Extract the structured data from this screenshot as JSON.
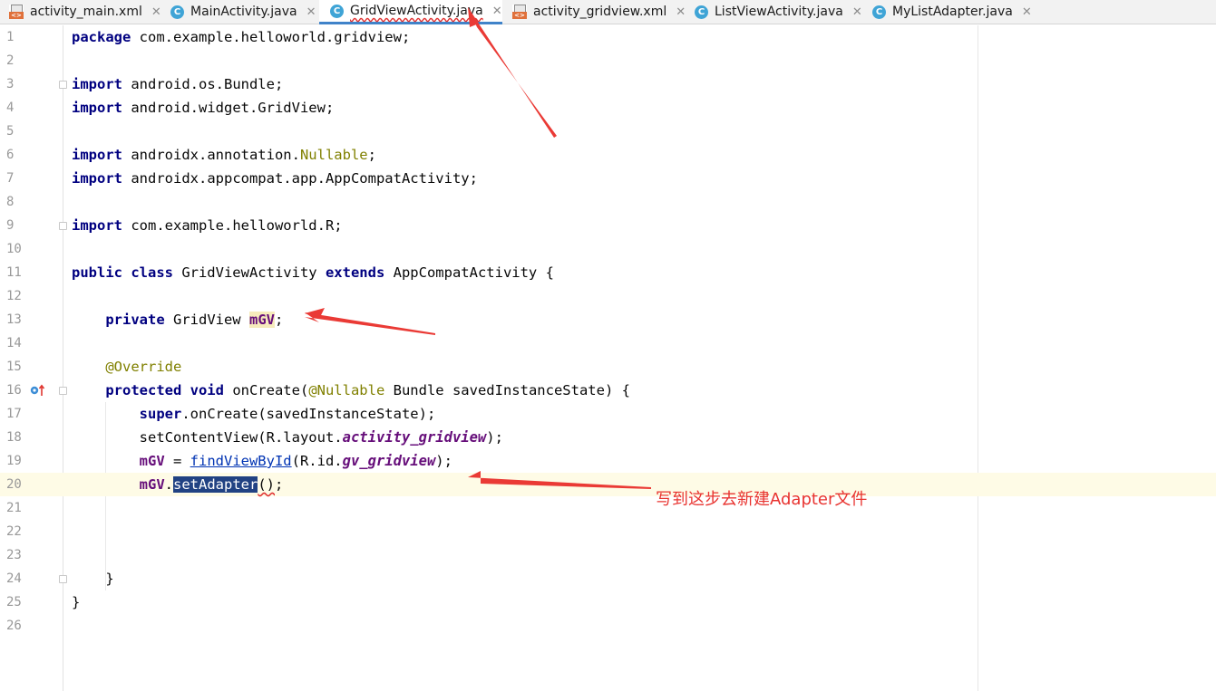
{
  "tabs": [
    {
      "label": "activity_main.xml",
      "type": "xml",
      "active": false
    },
    {
      "label": "MainActivity.java",
      "type": "java",
      "active": false
    },
    {
      "label": "GridViewActivity.java",
      "type": "java",
      "active": true
    },
    {
      "label": "activity_gridview.xml",
      "type": "xml",
      "active": false
    },
    {
      "label": "ListViewActivity.java",
      "type": "java",
      "active": false
    },
    {
      "label": "MyListAdapter.java",
      "type": "java",
      "active": false
    }
  ],
  "icons": {
    "java": "C",
    "xml": "<>",
    "close": "✕"
  },
  "line_numbers": [
    "1",
    "2",
    "3",
    "4",
    "5",
    "6",
    "7",
    "8",
    "9",
    "10",
    "11",
    "12",
    "13",
    "14",
    "15",
    "16",
    "17",
    "18",
    "19",
    "20",
    "21",
    "22",
    "23",
    "24",
    "25",
    "26"
  ],
  "code": {
    "l1_kw": "package",
    "l1_rest": " com.example.helloworld.gridview;",
    "l3_kw": "import",
    "l3_rest": " android.os.Bundle;",
    "l4_kw": "import",
    "l4_rest": " android.widget.GridView;",
    "l6_kw": "import",
    "l6_a": " androidx.annotation.",
    "l6_ann": "Nullable",
    "l6_b": ";",
    "l7_kw": "import",
    "l7_rest": " androidx.appcompat.app.AppCompatActivity;",
    "l9_kw": "import",
    "l9_rest": " com.example.helloworld.R;",
    "l11_kw1": "public class",
    "l11_a": " GridViewActivity ",
    "l11_kw2": "extends",
    "l11_b": " AppCompatActivity {",
    "l13_kw": "private",
    "l13_a": " GridView ",
    "l13_field": "mGV",
    "l13_b": ";",
    "l15_ann": "@Override",
    "l16_kw": "protected void",
    "l16_a": " onCreate(",
    "l16_ann": "@Nullable",
    "l16_b": " Bundle savedInstanceState) {",
    "l17_kw": "super",
    "l17_rest": ".onCreate(savedInstanceState);",
    "l18_a": "setContentView(R.layout.",
    "l18_field": "activity_gridview",
    "l18_b": ");",
    "l19_field": "mGV",
    "l19_a": " = ",
    "l19_link": "findViewById",
    "l19_b": "(R.id.",
    "l19_field2": "gv_gridview",
    "l19_c": ");",
    "l20_field": "mGV",
    "l20_a": ".",
    "l20_sel": "setAdapter",
    "l20_b": "()",
    "l20_c": ";",
    "l24": "}",
    "l25": "}"
  },
  "annotation": {
    "text": "写到这步去新建Adapter文件",
    "color": "#e8332f"
  }
}
